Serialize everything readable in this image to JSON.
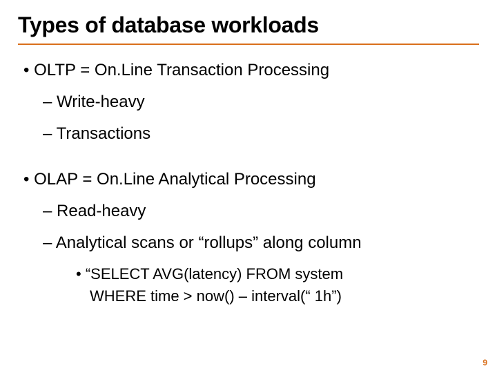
{
  "title": "Types of database workloads",
  "bullets": {
    "oltp": {
      "heading": "OLTP = On.Line Transaction Processing",
      "sub1": "Write-heavy",
      "sub2": "Transactions"
    },
    "olap": {
      "heading": "OLAP = On.Line Analytical Processing",
      "sub1": "Read-heavy",
      "sub2": "Analytical scans or “rollups” along column",
      "example_l1": "“SELECT AVG(latency) FROM system",
      "example_l2": "WHERE time > now() – interval(“ 1h”)"
    }
  },
  "page_number": "9"
}
